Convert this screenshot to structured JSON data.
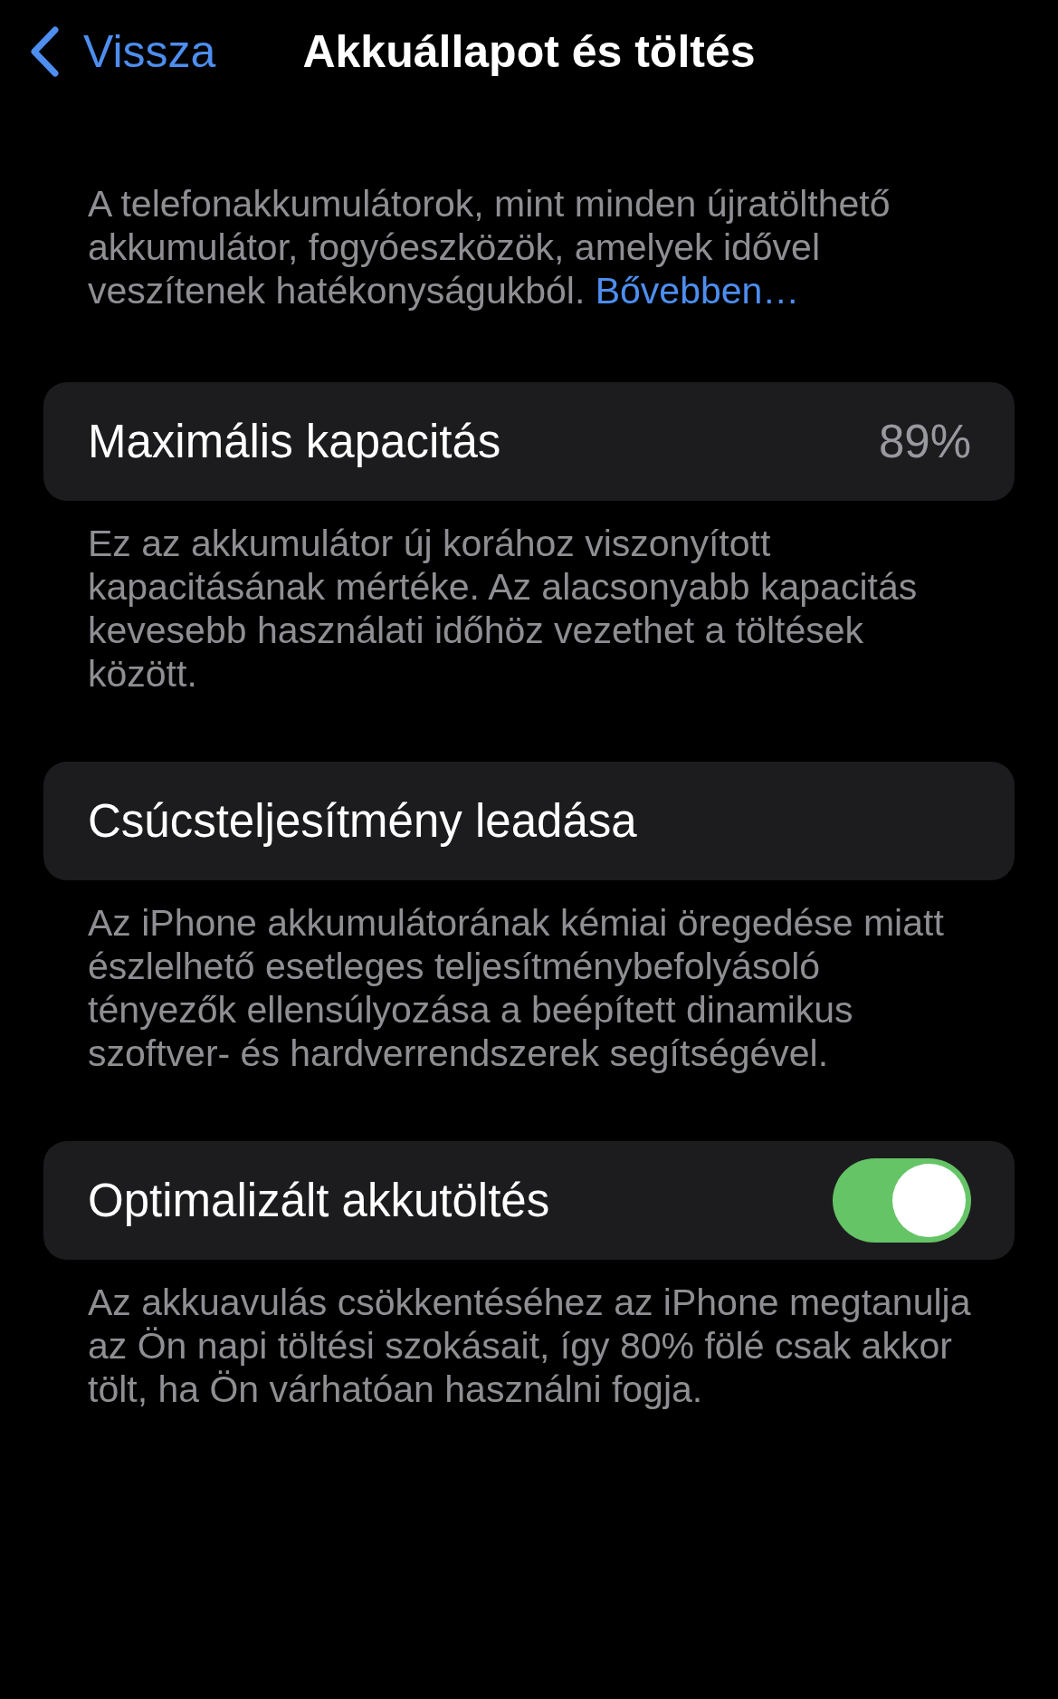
{
  "nav": {
    "back_label": "Vissza",
    "title": "Akkuállapot és töltés"
  },
  "intro": {
    "text": "A telefonakkumulátorok, mint minden újratölthető akkumulátor, fogyóeszközök, amelyek idővel veszítenek hatékonyságukból.",
    "link": "Bővebben…"
  },
  "sections": [
    {
      "kind": "value",
      "label": "Maximális kapacitás",
      "value": "89%",
      "footer": "Ez az akkumulátor új korához viszonyított kapacitásának mértéke. Az alacsonyabb kapacitás kevesebb használati időhöz vezethet a töltések között."
    },
    {
      "kind": "plain",
      "label": "Csúcsteljesítmény leadása",
      "footer": "Az iPhone akkumulátorának kémiai öregedése miatt észlelhető esetleges teljesítménybefolyásoló tényezők ellensúlyozása a beépített dinamikus szoftver- és hardverrendszerek segítségével."
    },
    {
      "kind": "toggle",
      "label": "Optimalizált akkutöltés",
      "on": true,
      "footer": "Az akkuavulás csökkentéséhez az iPhone megtanulja az Ön napi töltési szokásait, így 80% fölé csak akkor tölt, ha Ön várhatóan használni fogja."
    }
  ]
}
